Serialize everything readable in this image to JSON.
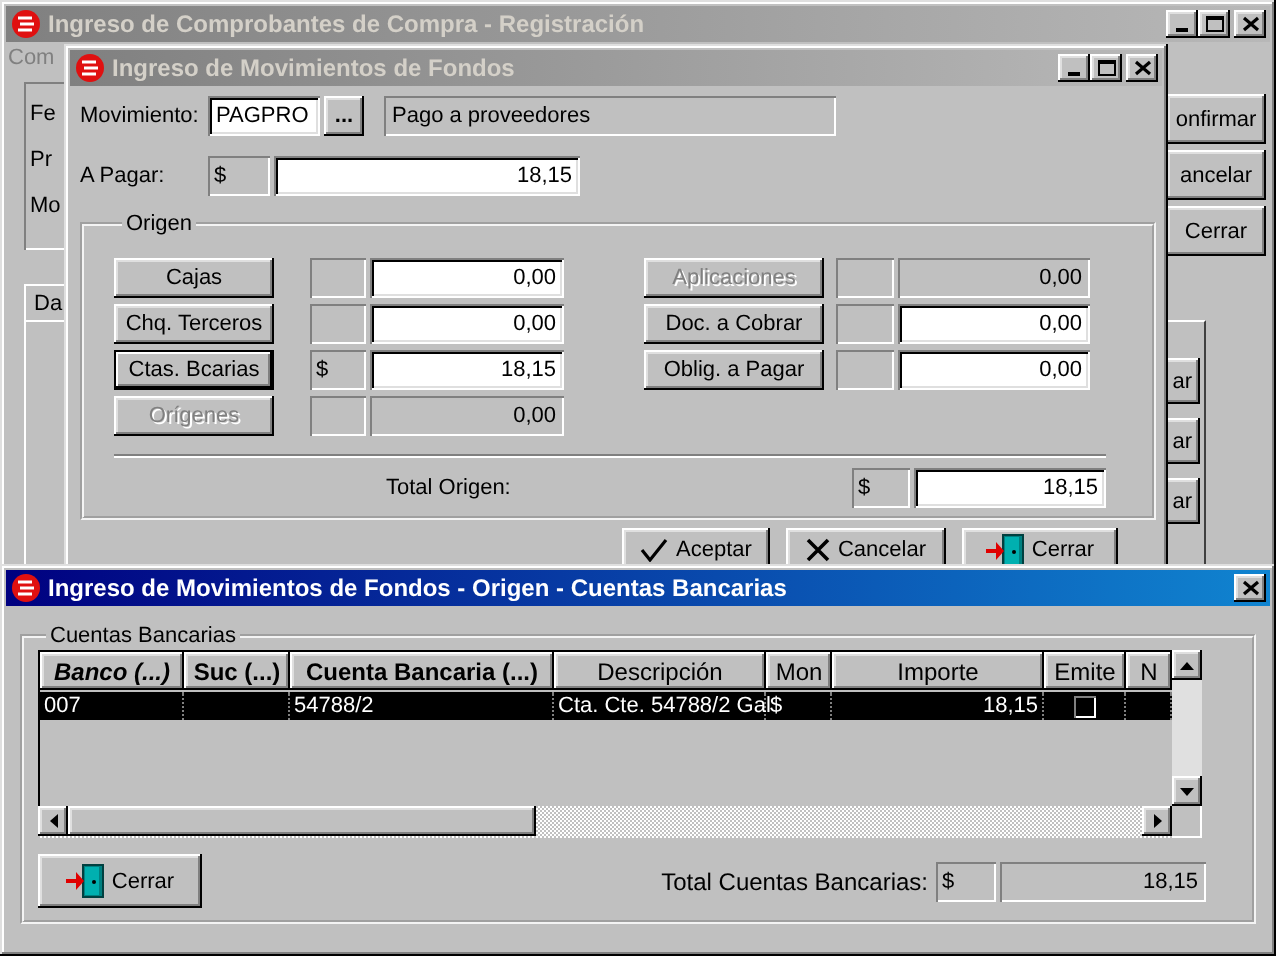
{
  "back_window": {
    "title": "Ingreso de Comprobantes de Compra - Registración",
    "active": false,
    "menu": "Com",
    "labels": [
      "Fe",
      "Pr",
      "Mo"
    ],
    "buttons": [
      "onfirmar",
      "ancelar",
      "Cerrar"
    ],
    "tab": "Da",
    "side_buttons": [
      "ar",
      "ar",
      "ar"
    ]
  },
  "fondos_window": {
    "title": "Ingreso de Movimientos de Fondos",
    "active": false,
    "movimiento": {
      "label": "Movimiento:",
      "code": "PAGPRO",
      "lookup_button": "...",
      "description": "Pago a proveedores"
    },
    "a_pagar": {
      "label": "A Pagar:",
      "currency": "$",
      "amount": "18,15"
    },
    "origen": {
      "title": "Origen",
      "left": [
        {
          "label": "Cajas",
          "amount": "0,00",
          "disabled": false,
          "default": false
        },
        {
          "label": "Chq. Terceros",
          "amount": "0,00",
          "disabled": false,
          "default": false
        },
        {
          "label": "Ctas. Bcarias",
          "currency": "$",
          "amount": "18,15",
          "disabled": false,
          "default": true
        },
        {
          "label": "Orígenes",
          "amount": "0,00",
          "disabled": true,
          "default": false
        }
      ],
      "right": [
        {
          "label": "Aplicaciones",
          "amount": "0,00",
          "disabled": true,
          "default": false
        },
        {
          "label": "Doc. a Cobrar",
          "amount": "0,00",
          "disabled": false,
          "default": false
        },
        {
          "label": "Oblig. a Pagar",
          "amount": "0,00",
          "disabled": false,
          "default": false
        }
      ],
      "total": {
        "label": "Total Origen:",
        "currency": "$",
        "amount": "18,15"
      }
    },
    "buttons": [
      {
        "label": "Aceptar",
        "kind": "accept"
      },
      {
        "label": "Cancelar",
        "kind": "cancel"
      },
      {
        "label": "Cerrar",
        "kind": "close"
      }
    ]
  },
  "cuentas_window": {
    "title": "Ingreso de Movimientos de Fondos - Origen - Cuentas Bancarias",
    "active": true,
    "group": "Cuentas Bancarias",
    "columns": [
      "Banco (...)",
      "Suc (...)",
      "Cuenta Bancaria (...)",
      "Descripción",
      "Mon",
      "Importe",
      "Emite",
      "N"
    ],
    "rows": [
      {
        "banco": "007",
        "cuenta": "54788/2",
        "descripcion": "Cta. Cte. 54788/2 Gal",
        "mon": "$",
        "importe": "18,15",
        "emite": false,
        "selected": true
      }
    ],
    "close_button": "Cerrar",
    "total": {
      "label": "Total Cuentas Bancarias:",
      "currency": "$",
      "amount": "18,15"
    }
  }
}
